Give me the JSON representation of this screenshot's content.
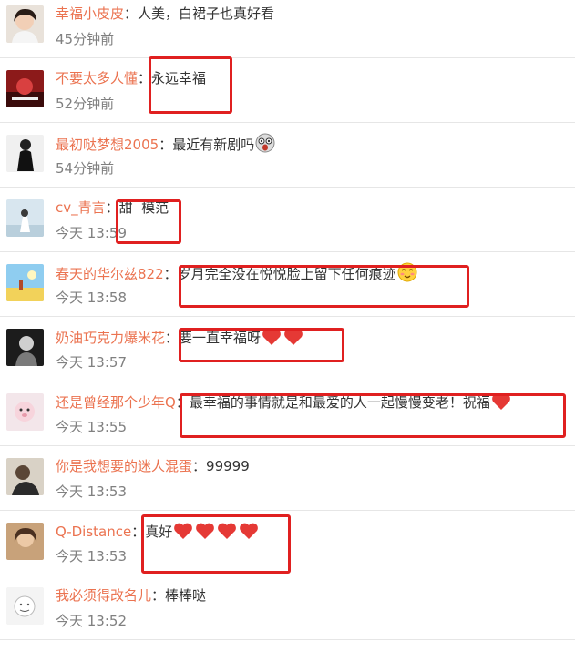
{
  "comments": [
    {
      "user": "幸福小皮皮",
      "sep": "：",
      "text": "人美，白裙子也真好看",
      "time": "45分钟前"
    },
    {
      "user": "不要太多人懂",
      "sep": "：",
      "text": "永远幸福",
      "time": "52分钟前"
    },
    {
      "user": "最初哒梦想2005",
      "sep": "：",
      "text": "最近有新剧吗",
      "time": "54分钟前",
      "emoji": "shocked-emoji"
    },
    {
      "user": "cv_青言",
      "sep": "：",
      "text": "甜  模范",
      "time": "今天 13:59"
    },
    {
      "user": "春天的华尔兹822",
      "sep": "：",
      "text": "岁月完全没在悦悦脸上留下任何痕迹",
      "time": "今天 13:58",
      "emoji": "blush-emoji"
    },
    {
      "user": "奶油巧克力爆米花",
      "sep": "：",
      "text": "要一直幸福呀",
      "time": "今天 13:57",
      "hearts": 2
    },
    {
      "user": "还是曾经那个少年Q",
      "sep": "：",
      "text": "最幸福的事情就是和最爱的人一起慢慢变老！祝福",
      "time": "今天 13:55",
      "hearts": 1
    },
    {
      "user": "你是我想要的迷人混蛋",
      "sep": "：",
      "text": "99999",
      "time": "今天 13:53"
    },
    {
      "user": "Q-Distance",
      "sep": "：",
      "text": "真好",
      "time": "今天 13:53",
      "hearts": 4
    },
    {
      "user": "我必须得改名儿",
      "sep": "：",
      "text": "棒棒哒",
      "time": "今天 13:52"
    }
  ],
  "colors": {
    "username": "#eb7350",
    "text": "#333333",
    "time": "#808080",
    "highlight": "#e02020",
    "divider": "#e6e6e6"
  }
}
